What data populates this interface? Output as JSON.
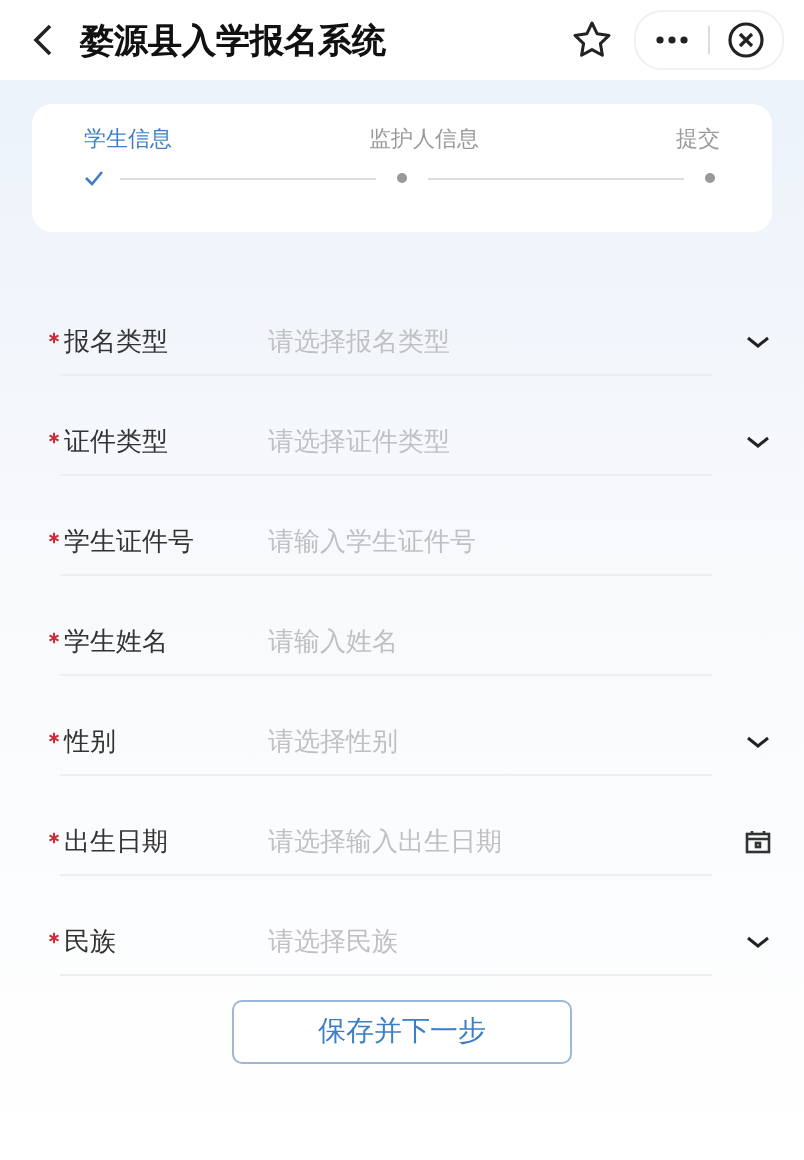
{
  "header": {
    "title": "婺源县入学报名系统"
  },
  "steps": [
    {
      "label": "学生信息",
      "done": true,
      "selected": true
    },
    {
      "label": "监护人信息",
      "done": false,
      "selected": false
    },
    {
      "label": "提交",
      "done": false,
      "selected": false
    }
  ],
  "fields": [
    {
      "label": "报名类型",
      "placeholder": "请选择报名类型",
      "required": true,
      "kind": "select"
    },
    {
      "label": "证件类型",
      "placeholder": "请选择证件类型",
      "required": true,
      "kind": "select"
    },
    {
      "label": "学生证件号",
      "placeholder": "请输入学生证件号",
      "required": true,
      "kind": "input"
    },
    {
      "label": "学生姓名",
      "placeholder": "请输入姓名",
      "required": true,
      "kind": "input"
    },
    {
      "label": "性别",
      "placeholder": "请选择性别",
      "required": true,
      "kind": "select"
    },
    {
      "label": "出生日期",
      "placeholder": "请选择输入出生日期",
      "required": true,
      "kind": "date"
    },
    {
      "label": "民族",
      "placeholder": "请选择民族",
      "required": true,
      "kind": "select"
    }
  ],
  "button": {
    "label": "保存并下一步"
  }
}
